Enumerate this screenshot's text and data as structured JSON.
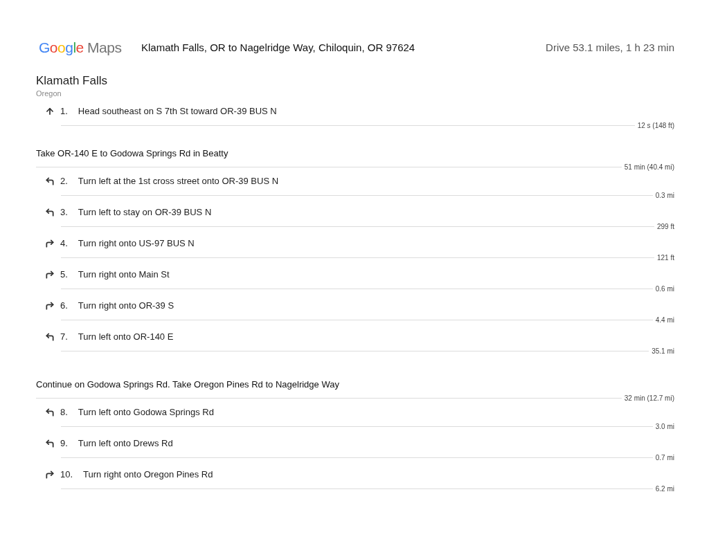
{
  "header": {
    "logo": "Google Maps",
    "title": "Klamath Falls, OR to Nagelridge Way, Chiloquin, OR 97624",
    "summary": "Drive 53.1 miles, 1 h 23 min"
  },
  "start": {
    "name": "Klamath Falls",
    "region": "Oregon"
  },
  "start_steps": [
    {
      "kind": "straight",
      "number": "1.",
      "text": "Head southeast on S 7th St toward OR-39 BUS N",
      "distance": "12 s (148 ft)"
    }
  ],
  "groups": [
    {
      "title": "Take OR-140 E to Godowa Springs Rd in Beatty",
      "summary": "51 min (40.4 mi)",
      "steps": [
        {
          "kind": "left",
          "number": "2.",
          "text": "Turn left at the 1st cross street onto OR-39 BUS N",
          "distance": "0.3 mi"
        },
        {
          "kind": "left",
          "number": "3.",
          "text": "Turn left to stay on OR-39 BUS N",
          "distance": "299 ft"
        },
        {
          "kind": "right",
          "number": "4.",
          "text": "Turn right onto US-97 BUS N",
          "distance": "121 ft"
        },
        {
          "kind": "right",
          "number": "5.",
          "text": "Turn right onto Main St",
          "distance": "0.6 mi"
        },
        {
          "kind": "right",
          "number": "6.",
          "text": "Turn right onto OR-39 S",
          "distance": "4.4 mi"
        },
        {
          "kind": "left",
          "number": "7.",
          "text": "Turn left onto OR-140 E",
          "distance": "35.1 mi"
        }
      ]
    },
    {
      "title": "Continue on Godowa Springs Rd. Take Oregon Pines Rd to Nagelridge Way",
      "summary": "32 min (12.7 mi)",
      "steps": [
        {
          "kind": "left",
          "number": "8.",
          "text": "Turn left onto Godowa Springs Rd",
          "distance": "3.0 mi"
        },
        {
          "kind": "left",
          "number": "9.",
          "text": "Turn left onto Drews Rd",
          "distance": "0.7 mi"
        },
        {
          "kind": "right",
          "number": "10.",
          "text": "Turn right onto Oregon Pines Rd",
          "distance": "6.2 mi"
        }
      ]
    }
  ]
}
